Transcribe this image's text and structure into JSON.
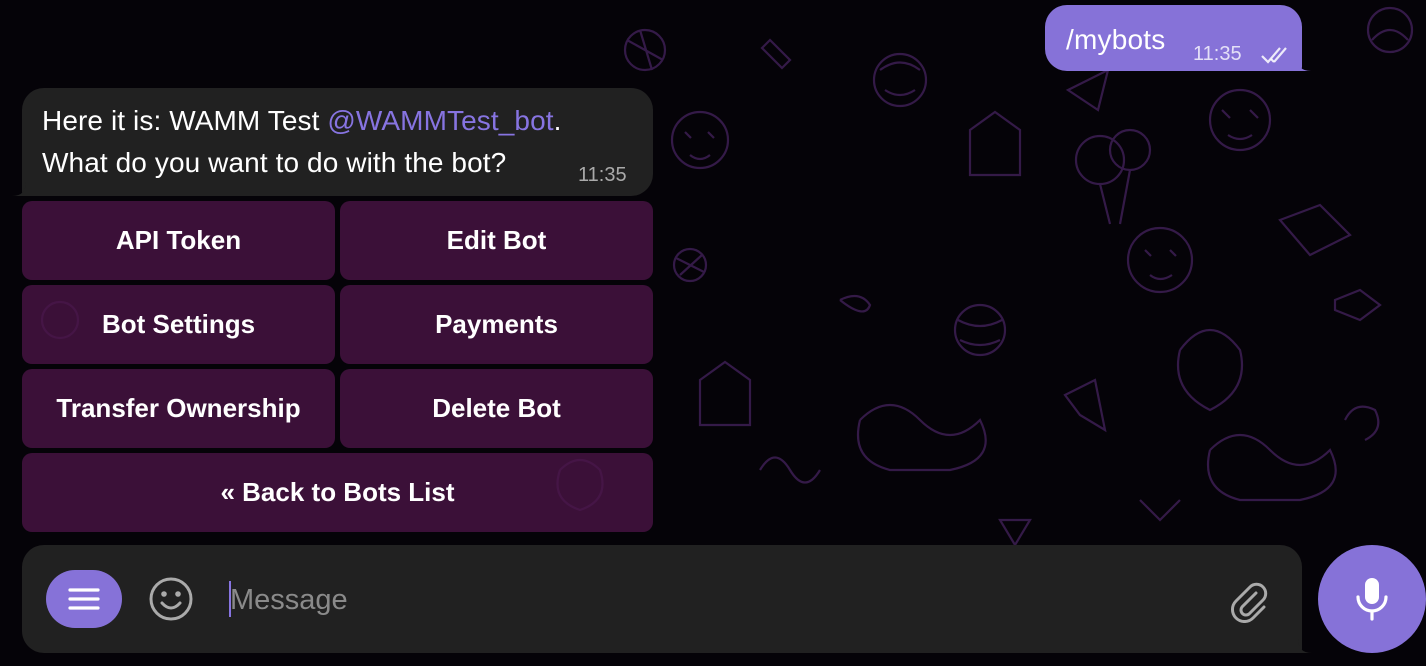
{
  "outgoing": {
    "text": "/mybots",
    "time": "11:35"
  },
  "incoming": {
    "text_prefix": "Here it is: WAMM Test ",
    "mention": "@WAMMTest_bot",
    "text_suffix": ".",
    "line2": "What do you want to do with the bot?",
    "time": "11:35"
  },
  "keyboard": {
    "api_token": "API Token",
    "edit_bot": "Edit Bot",
    "bot_settings": "Bot Settings",
    "payments": "Payments",
    "transfer_ownership": "Transfer Ownership",
    "delete_bot": "Delete Bot",
    "back": "« Back to Bots List"
  },
  "composer": {
    "placeholder": "Message"
  },
  "icons": {
    "menu": "menu-icon",
    "emoji": "smile-icon",
    "attach": "paperclip-icon",
    "mic": "microphone-icon",
    "read": "double-check-icon"
  },
  "colors": {
    "accent": "#8672d8",
    "link": "#8774e1",
    "bubble_in": "#212121",
    "keyboard_button": "#4a1446"
  }
}
